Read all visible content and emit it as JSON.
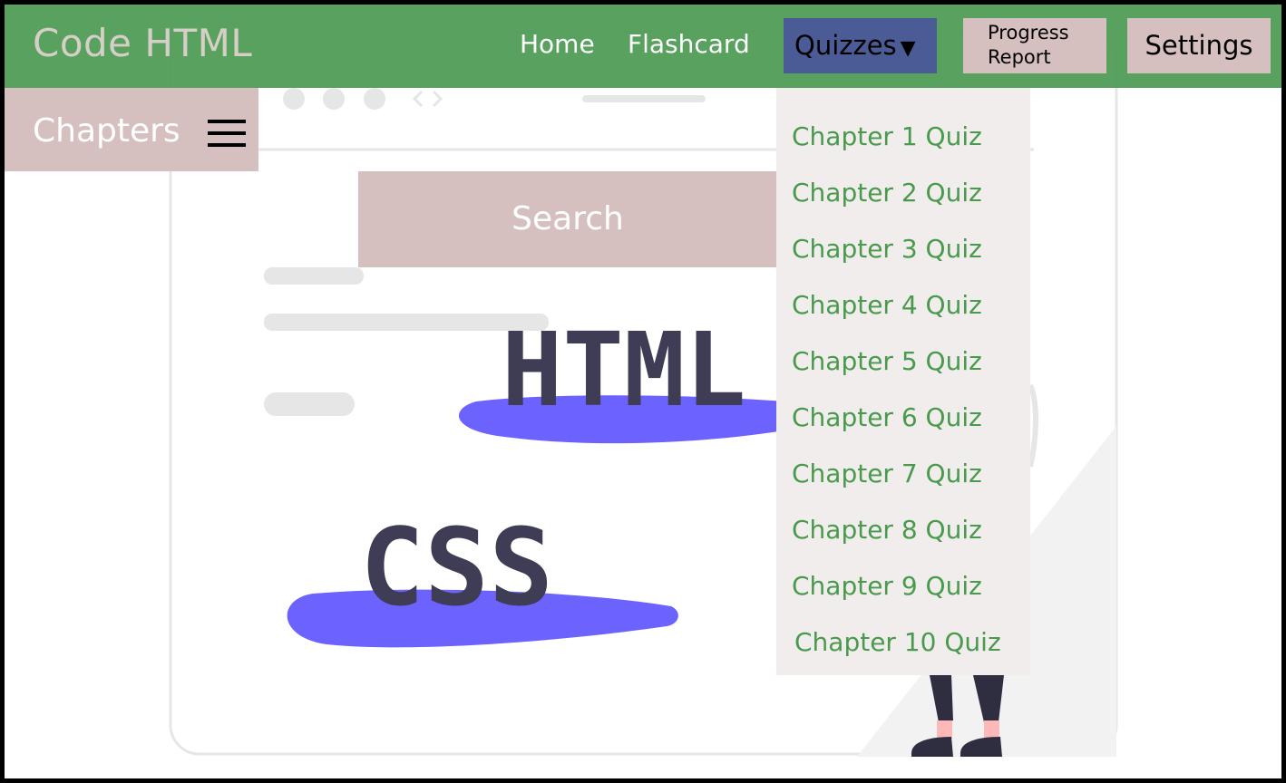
{
  "brand": "Code HTML",
  "nav": {
    "home": "Home",
    "flashcard": "Flashcard",
    "quizzes": "Quizzes",
    "progress_line1": "Progress",
    "progress_line2": "Report",
    "settings": "Settings"
  },
  "sidebar": {
    "chapters_label": "Chapters",
    "menu_icon": "hamburger-menu-icon"
  },
  "search": {
    "label": "Search"
  },
  "hero": {
    "html_text": "HTML",
    "css_text": "CSS"
  },
  "quiz_menu": {
    "items": [
      "Chapter 1 Quiz",
      "Chapter 2 Quiz",
      "Chapter 3 Quiz",
      "Chapter 4 Quiz",
      "Chapter 5 Quiz",
      "Chapter 6 Quiz",
      "Chapter 7 Quiz",
      "Chapter 8 Quiz",
      "Chapter 9 Quiz",
      "Chapter 10 Quiz"
    ]
  },
  "colors": {
    "nav_green": "#4c9a52",
    "quizzes_active": "#4b5b95",
    "tab_pink": "#d5c0bf",
    "menu_text_green": "#4a9a4e",
    "brush_purple": "#6c63ff",
    "code_text": "#3f3d56"
  }
}
